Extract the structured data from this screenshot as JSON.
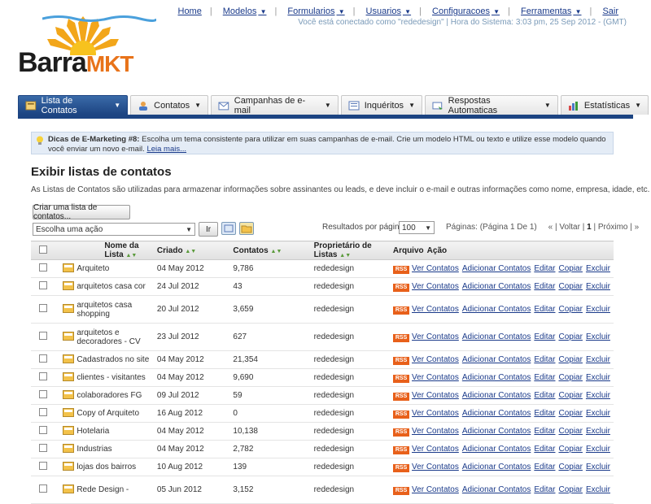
{
  "logo": {
    "text1": "Barra",
    "text2": "MKT"
  },
  "topnav": {
    "items": [
      {
        "label": "Home",
        "caret": false
      },
      {
        "label": "Modelos",
        "caret": true
      },
      {
        "label": "Formularios",
        "caret": true
      },
      {
        "label": "Usuarios",
        "caret": true
      },
      {
        "label": "Configuracoes",
        "caret": true
      },
      {
        "label": "Ferramentas",
        "caret": true
      },
      {
        "label": "Sair",
        "caret": false
      }
    ],
    "status": "Você está conectado como \"rededesign\" | Hora do Sistema: 3:03 pm, 25 Sep 2012 - (GMT)"
  },
  "tabs": [
    {
      "label": "Lista de Contatos",
      "icon": "contact-list-icon",
      "active": true
    },
    {
      "label": "Contatos",
      "icon": "contacts-icon",
      "active": false
    },
    {
      "label": "Campanhas de e-mail",
      "icon": "envelope-icon",
      "active": false
    },
    {
      "label": "Inquéritos",
      "icon": "survey-icon",
      "active": false
    },
    {
      "label": "Respostas Automaticas",
      "icon": "autoresponder-icon",
      "active": false
    },
    {
      "label": "Estatísticas",
      "icon": "bar-chart-icon",
      "active": false
    }
  ],
  "tip": {
    "title": "Dicas de E-Marketing #8:",
    "text": "Escolha um tema consistente para utilizar em suas campanhas de e-mail. Crie um modelo HTML ou texto e utilize esse modelo quando você enviar um novo e-mail.",
    "link": "Leia mais..."
  },
  "page": {
    "title": "Exibir listas de contatos",
    "description": "As Listas de Contatos são utilizadas para armazenar informações sobre assinantes ou leads, e deve incluir o e-mail e outras informações como nome, empresa, idade, etc.",
    "create_button": "Criar uma lista de contatos...",
    "action_select": "Escolha uma ação",
    "go_button": "Ir",
    "results_label": "Resultados por página:",
    "results_value": "100",
    "pagination": {
      "info": "Páginas: (Página 1 De 1)",
      "first": "«",
      "prev": "| Voltar |",
      "current": "1",
      "next": "| Próximo |",
      "last": "»"
    }
  },
  "table": {
    "headers": {
      "name": "Nome da Lista",
      "created": "Criado",
      "contacts": "Contatos",
      "owner": "Proprietário de Listas",
      "archive": "Arquivo",
      "action": "Ação"
    },
    "actions": {
      "rss": "RSS",
      "view": "Ver Contatos",
      "add": "Adicionar Contatos",
      "edit": "Editar",
      "copy": "Copiar",
      "delete": "Excluir"
    },
    "rows": [
      {
        "name": "Arquiteto",
        "created": "04 May 2012",
        "contacts": "9,786",
        "owner": "rededesign"
      },
      {
        "name": "arquitetos casa cor",
        "created": "24 Jul 2012",
        "contacts": "43",
        "owner": "rededesign"
      },
      {
        "name": "arquitetos casa shopping",
        "created": "20 Jul 2012",
        "contacts": "3,659",
        "owner": "rededesign"
      },
      {
        "name": "arquitetos e decoradores - CV",
        "created": "23 Jul 2012",
        "contacts": "627",
        "owner": "rededesign"
      },
      {
        "name": "Cadastrados no site",
        "created": "04 May 2012",
        "contacts": "21,354",
        "owner": "rededesign"
      },
      {
        "name": "clientes - visitantes",
        "created": "04 May 2012",
        "contacts": "9,690",
        "owner": "rededesign"
      },
      {
        "name": "colaboradores FG",
        "created": "09 Jul 2012",
        "contacts": "59",
        "owner": "rededesign"
      },
      {
        "name": "Copy of Arquiteto",
        "created": "16 Aug 2012",
        "contacts": "0",
        "owner": "rededesign"
      },
      {
        "name": "Hotelaria",
        "created": "04 May 2012",
        "contacts": "10,138",
        "owner": "rededesign"
      },
      {
        "name": "Industrias",
        "created": "04 May 2012",
        "contacts": "2,782",
        "owner": "rededesign"
      },
      {
        "name": "lojas dos bairros",
        "created": "10 Aug 2012",
        "contacts": "139",
        "owner": "rededesign"
      },
      {
        "name": "Rede Design -",
        "created": "05 Jun 2012",
        "contacts": "3,152",
        "owner": "rededesign"
      }
    ]
  }
}
